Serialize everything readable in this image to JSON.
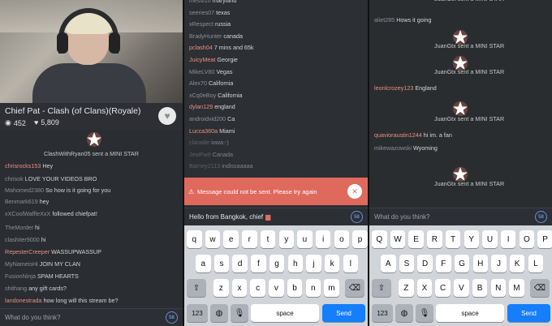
{
  "panel1": {
    "stream_title": "Chief Pat - Clash (of Clans)(Royale)",
    "viewers": "452",
    "likes": "5,809",
    "sysline": "ClashWithRyan05 sent a MINI STAR",
    "messages": [
      {
        "user": "chrisrocks153",
        "text": "Hey",
        "ucolor": "red"
      },
      {
        "user": "chrisok",
        "text": "LOVE YOUR VIDEOS BRO",
        "ucolor": "gray"
      },
      {
        "user": "Mahomed2380",
        "text": "So how is it going for you",
        "ucolor": "gray"
      },
      {
        "user": "Benmark619",
        "text": "hey",
        "ucolor": "gray"
      },
      {
        "user": "xXCoolWaffleXxX",
        "text": " followed chiefpat!",
        "ucolor": "gray"
      },
      {
        "user": "TheMorder",
        "text": "hi",
        "ucolor": "gray"
      },
      {
        "user": "clashiter9000",
        "text": "hi",
        "ucolor": "gray"
      },
      {
        "user": "RepesterCreeper",
        "text": "WASSUPWASSUP",
        "ucolor": "red"
      },
      {
        "user": "MyNameisHi",
        "text": "JOIN MY CLAN",
        "ucolor": "gray"
      },
      {
        "user": "FusionNinja",
        "text": "SPAM HEARTS",
        "ucolor": "gray"
      },
      {
        "user": "shithang",
        "text": "any gift cards?",
        "ucolor": "gray"
      },
      {
        "user": "landonestrada",
        "text": "how long will this stream be?",
        "ucolor": "red"
      }
    ],
    "input_placeholder": "What do you think?"
  },
  "panel2": {
    "messages": [
      {
        "user": "messi10",
        "text": "maryland"
      },
      {
        "user": "seeries07",
        "text": "texas"
      },
      {
        "user": "xRespect",
        "text": "russia"
      },
      {
        "user": "BradyHunter",
        "text": "canada"
      },
      {
        "user": "pclash04",
        "text": "7 mins and 65k"
      },
      {
        "user": "JuicyMeat",
        "text": "Georgie"
      },
      {
        "user": "MikeLV80",
        "text": "Vegas"
      },
      {
        "user": "Alex70",
        "text": "California"
      },
      {
        "user": "xCq0eBoy",
        "text": "California"
      },
      {
        "user": "dylan129",
        "text": "england"
      },
      {
        "user": "androidvid200",
        "text": "Ca"
      },
      {
        "user": "Lucca360a",
        "text": "Miami"
      },
      {
        "user": "claradie",
        "text": "iowa:-)"
      },
      {
        "user": "JewPw9",
        "text": "Canada"
      },
      {
        "user": "Barney2113",
        "text": "indissaaaaa"
      }
    ],
    "error": "Message could not be sent. Please try again",
    "input_text": "Hello from Bangkok, chief",
    "keyboard": {
      "row1": [
        "q",
        "w",
        "e",
        "r",
        "t",
        "y",
        "u",
        "i",
        "o",
        "p"
      ],
      "row2": [
        "a",
        "s",
        "d",
        "f",
        "g",
        "h",
        "j",
        "k",
        "l"
      ],
      "row3": [
        "z",
        "x",
        "c",
        "v",
        "b",
        "n",
        "m"
      ],
      "num": "123",
      "space": "space",
      "send": "Send"
    }
  },
  "panel3": {
    "events": [
      {
        "type": "sys",
        "text": "JuanGtx sent a MINI STAR"
      },
      {
        "type": "msg",
        "user": "aliet285",
        "text": "Hows it going"
      },
      {
        "type": "sys",
        "text": "JuanGtx sent a MINI STAR"
      },
      {
        "type": "sys",
        "text": "JuanGtx sent a MINI STAR"
      },
      {
        "type": "msg",
        "user": "leonlcrozey123",
        "text": "England"
      },
      {
        "type": "sys",
        "text": "JuanGtx sent a MINI STAR"
      },
      {
        "type": "msg",
        "user": "quavioraustin1244",
        "text": "hi im. a fan"
      },
      {
        "type": "msg",
        "user": "mikewazowski",
        "text": "Wyoming"
      },
      {
        "type": "sys",
        "text": "JuanGtx sent a MINI STAR"
      }
    ],
    "input_placeholder": "What do you think?",
    "keyboard": {
      "row1": [
        "Q",
        "W",
        "E",
        "R",
        "T",
        "Y",
        "U",
        "I",
        "O",
        "P"
      ],
      "row2": [
        "A",
        "S",
        "D",
        "F",
        "G",
        "H",
        "J",
        "K",
        "L"
      ],
      "row3": [
        "Z",
        "X",
        "C",
        "V",
        "B",
        "N",
        "M"
      ],
      "num": "123",
      "space": "space",
      "send": "Send"
    }
  },
  "colors": {
    "accent_red": "#e98f83",
    "error": "#e0695e",
    "send_blue": "#147efb"
  },
  "icons": [
    "eye-icon",
    "heart-icon",
    "star-icon",
    "mic-icon",
    "globe-icon",
    "shift-icon",
    "backspace-icon",
    "close-icon"
  ]
}
